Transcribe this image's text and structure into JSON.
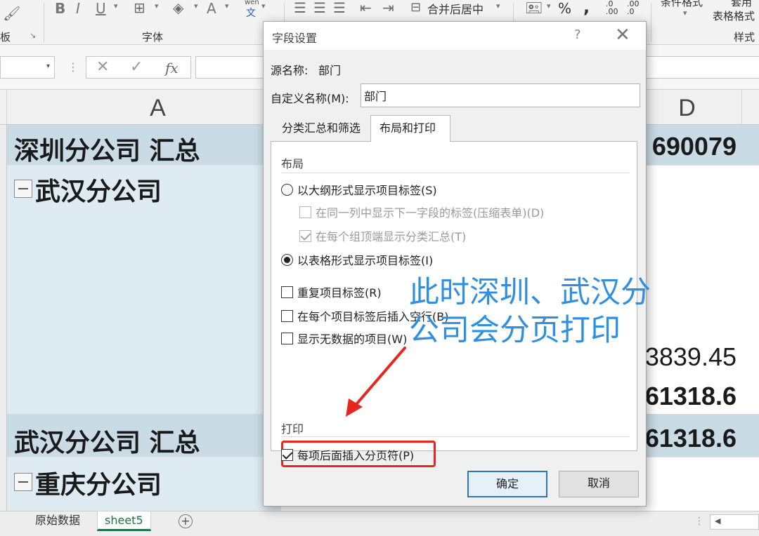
{
  "ribbon": {
    "font_group_label": "字体",
    "clipboard_group_label": "板",
    "styles_group_label": "样式",
    "merge_center": "合并后居中",
    "percent": "%",
    "comma": ",",
    "cond_format": "条件格式",
    "table_format_1": "套用",
    "table_format_2": "表格格式",
    "bold": "B",
    "italic": "I",
    "underline": "U",
    "font_color": "A",
    "wen": "wen",
    "wen_char": "文",
    "inc_decimal": ".0 .00",
    "dec_decimal": ".00 .0"
  },
  "formula_bar": {
    "fx": "fx",
    "cancel": "✕",
    "enter": "✓"
  },
  "grid": {
    "col_a": "A",
    "col_d": "D",
    "rows": [
      {
        "a": "深圳分公司 汇总",
        "d": "690079",
        "total": true
      },
      {
        "a": "武汉分公司",
        "d": "",
        "group": true
      },
      {
        "a": "",
        "d": ""
      },
      {
        "a": "",
        "d": ""
      },
      {
        "a": "",
        "d": "3839.45"
      },
      {
        "a": "",
        "d": "61318.6",
        "bold": true
      },
      {
        "a": "武汉分公司 汇总",
        "d": "61318.6",
        "total": true
      },
      {
        "a": "重庆分公司",
        "d": "",
        "group": true
      }
    ]
  },
  "sheet_tabs": {
    "tab1": "原始数据",
    "tab2": "sheet5",
    "add": "+"
  },
  "dialog": {
    "title": "字段设置",
    "help": "?",
    "close": "✕",
    "source_label": "源名称:",
    "source_value": "部门",
    "custom_label": "自定义名称(M):",
    "custom_value": "部门",
    "tabs": [
      "分类汇总和筛选",
      "布局和打印"
    ],
    "layout_section": "布局",
    "opt_outline": "以大纲形式显示项目标签(S)",
    "opt_compact": "在同一列中显示下一字段的标签(压缩表单)(D)",
    "opt_subtotal_top": "在每个组顶端显示分类汇总(T)",
    "opt_tabular": "以表格形式显示项目标签(I)",
    "opt_repeat": "重复项目标签(R)",
    "opt_blank_line": "在每个项目标签后插入空行(B)",
    "opt_no_data": "显示无数据的项目(W)",
    "print_section": "打印",
    "opt_page_break": "每项后面插入分页符(P)",
    "ok": "确定",
    "cancel": "取消"
  },
  "annotation": {
    "line1": "此时深圳、武汉分",
    "line2": "公司会分页打印"
  },
  "colors": {
    "annotation": "#2f8fe0",
    "highlight": "#e8261f",
    "total_row": "#c9dce6",
    "group_area": "#deebf3",
    "excel_green": "#217346"
  }
}
